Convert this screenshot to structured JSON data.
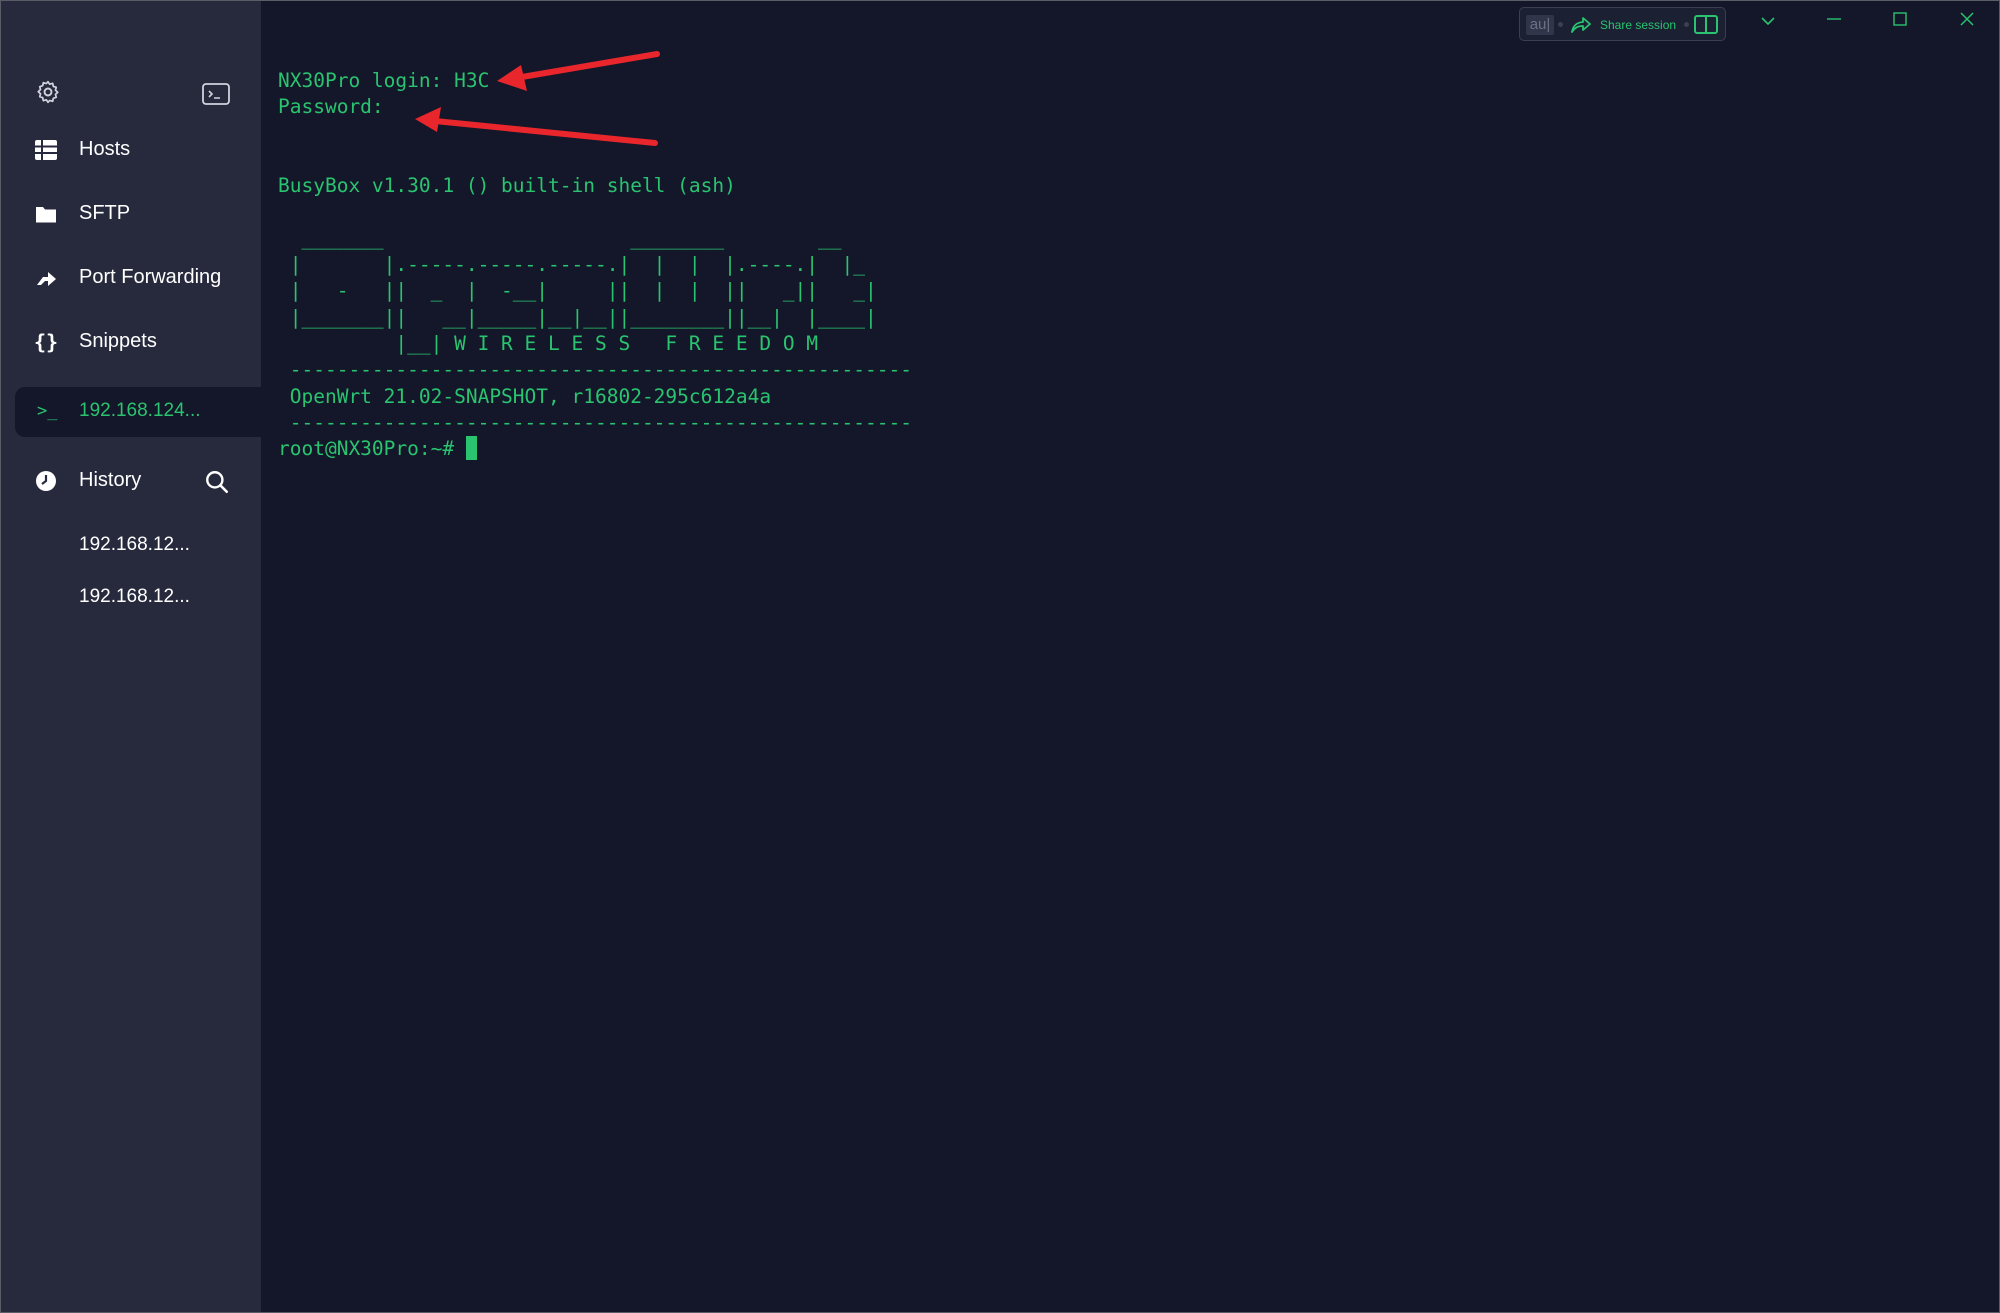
{
  "sidebar": {
    "settings_icon": "gear-icon",
    "new_terminal_icon": "terminal-icon",
    "nav": [
      {
        "icon": "hosts-grid-icon",
        "label": "Hosts"
      },
      {
        "icon": "folder-icon",
        "label": "SFTP"
      },
      {
        "icon": "port-forward-arrow-icon",
        "label": "Port Forwarding"
      },
      {
        "icon": "braces-icon",
        "label": "Snippets"
      }
    ],
    "active_session": {
      "icon": "prompt-icon",
      "label": "192.168.124..."
    },
    "history": {
      "icon": "clock-icon",
      "label": "History",
      "search_icon": "search-icon"
    },
    "history_items": [
      "192.168.12...",
      "192.168.12..."
    ]
  },
  "titlebar": {
    "input_value": "au|",
    "share_label": "Share session",
    "share_icon": "share-arrow-icon",
    "split_icon": "split-view-icon",
    "controls": [
      "chevron-down-icon",
      "minimize-icon",
      "maximize-icon",
      "close-icon"
    ]
  },
  "terminal": {
    "lines": [
      "NX30Pro login: H3C",
      "Password:",
      "",
      "",
      "BusyBox v1.30.1 () built-in shell (ash)",
      "",
      "  _______                     ________        __",
      " |       |.-----.-----.-----.|  |  |  |.----.|  |_",
      " |   -   ||  _  |  -__|     ||  |  |  ||   _||   _|",
      " |_______||   __|_____|__|__||________||__|  |____|",
      "          |__| W I R E L E S S   F R E E D O M",
      " -----------------------------------------------------",
      " OpenWrt 21.02-SNAPSHOT, r16802-295c612a4a",
      " -----------------------------------------------------"
    ],
    "prompt": "root@NX30Pro:~# "
  },
  "colors": {
    "terminal_bg": "#131729",
    "sidebar_bg": "#272a3d",
    "terminal_text": "#2ac36f",
    "annotation_arrow": "#e8262c"
  }
}
